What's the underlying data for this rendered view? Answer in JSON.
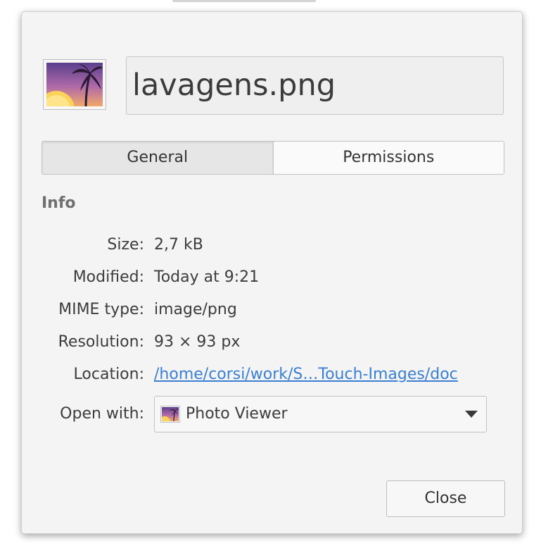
{
  "dialog": {
    "filename": "lavagens.png",
    "file_icon": "image-file-icon",
    "tabs": [
      {
        "label": "General",
        "active": true
      },
      {
        "label": "Permissions",
        "active": false
      }
    ],
    "section_title": "Info",
    "info": {
      "size_label": "Size:",
      "size_value": "2,7 kB",
      "modified_label": "Modified:",
      "modified_value": "Today at 9:21",
      "mime_label": "MIME type:",
      "mime_value": "image/png",
      "resolution_label": "Resolution:",
      "resolution_value": "93 × 93 px",
      "location_label": "Location:",
      "location_value": "/home/corsi/work/S…Touch-Images/doc"
    },
    "open_with": {
      "label": "Open with:",
      "selected": "Photo Viewer",
      "icon": "photo-viewer-icon"
    },
    "close_label": "Close"
  },
  "colors": {
    "link": "#3a7fd2",
    "background": "#f4f4f4",
    "section_title": "#6f6f6f"
  }
}
